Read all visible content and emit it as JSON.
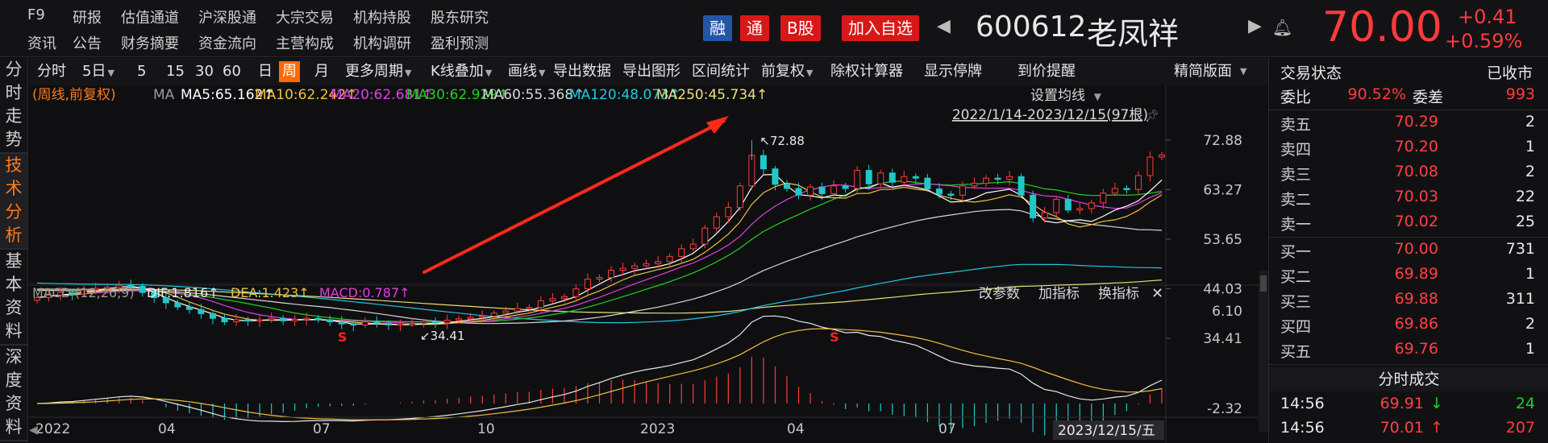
{
  "nav": {
    "row1": [
      "F9",
      "研报",
      "估值通道",
      "沪深股通",
      "大宗交易",
      "机构持股",
      "股东研究"
    ],
    "row2": [
      "资讯",
      "公告",
      "财务摘要",
      "资金流向",
      "主营构成",
      "机构调研",
      "盈利预测"
    ]
  },
  "tags": {
    "rong": "融",
    "tong": "通",
    "bgu": "B股",
    "add": "加入自选"
  },
  "stock": {
    "code": "600612",
    "name": "老凤祥",
    "price": "70.00",
    "change": "+0.41",
    "change_pct": "+0.59%"
  },
  "side_tabs": [
    "分时走势",
    "技术分析",
    "基本资料",
    "深度资料"
  ],
  "toolbar": {
    "items": [
      "分时",
      "5日",
      "5",
      "15",
      "30",
      "60",
      "日",
      "周",
      "月",
      "更多周期",
      "K线叠加",
      "画线",
      "导出数据",
      "导出图形",
      "区间统计",
      "前复权",
      "除权计算器",
      "显示停牌",
      "到价提醒"
    ],
    "active": "周",
    "right": "精简版面"
  },
  "ma_legend": {
    "prefix": "(周线,前复权)",
    "ma_label": "MA",
    "items": [
      "MA5:65.162↑",
      "MA10:62.242↑",
      "MA20:62.681↑",
      "MA30:62.929↑",
      "MA60:55.368↑",
      "MA120:48.073↑",
      "MA250:45.734↑"
    ],
    "settings": "设置均线",
    "range": "2022/1/14-2023/12/15(97根)"
  },
  "colors": {
    "ma5": "#ffffff",
    "ma10": "#f0c040",
    "ma20": "#e040e0",
    "ma30": "#20d020",
    "ma60": "#d8d8d8",
    "ma120": "#20c8e0",
    "ma250": "#e8e080",
    "up": "#ff3b3b",
    "down": "#20c8c8",
    "arrow": "#ff2a1a"
  },
  "chart_annotations": {
    "high": "72.88",
    "low": "34.41",
    "s_marker": "S"
  },
  "macd": {
    "title": "MACD (12,26,9)",
    "dif": "DIF:1.816↑",
    "dea": "DEA:1.423↑",
    "macd": "MACD:0.787↑",
    "btn_params": "改参数",
    "btn_add": "加指标",
    "btn_swap": "换指标",
    "close": "✕"
  },
  "chart_data": {
    "type": "candlestick",
    "y_ticks": [
      "72.88",
      "63.27",
      "53.65",
      "44.03",
      "34.41"
    ],
    "ylim": [
      34.41,
      72.88
    ],
    "macd_ticks": [
      "6.10",
      "-2.32"
    ],
    "macd_lim": [
      -2.32,
      6.1
    ],
    "x_labels": [
      "2022",
      "04",
      "07",
      "10",
      "2023",
      "04",
      "07"
    ],
    "crosshair_label": "2023/12/15/五",
    "weekly_closes": [
      42.3,
      42.8,
      43.3,
      43.0,
      43.8,
      44.1,
      44.3,
      44.7,
      44.5,
      43.3,
      42.3,
      41.3,
      40.5,
      40.0,
      39.2,
      38.3,
      37.6,
      38.0,
      37.8,
      38.0,
      38.3,
      37.8,
      38.1,
      38.3,
      38.0,
      37.6,
      37.2,
      37.0,
      37.6,
      37.3,
      37.0,
      37.2,
      37.3,
      37.6,
      37.4,
      37.9,
      38.2,
      38.5,
      38.7,
      39.3,
      39.7,
      40.2,
      40.4,
      41.7,
      42.1,
      42.5,
      44.0,
      45.9,
      46.2,
      47.6,
      48.0,
      48.5,
      48.9,
      49.3,
      50.3,
      51.8,
      52.7,
      55.8,
      58.0,
      59.8,
      64.0,
      69.9,
      67.3,
      64.3,
      63.5,
      62.2,
      63.8,
      62.5,
      64.0,
      63.5,
      67.0,
      64.4,
      66.5,
      64.7,
      65.8,
      65.5,
      63.4,
      62.4,
      62.2,
      64.0,
      64.5,
      65.5,
      65.3,
      65.8,
      62.2,
      57.8,
      58.8,
      61.4,
      59.3,
      59.6,
      60.7,
      62.6,
      63.5,
      63.3,
      66.0,
      69.6,
      70.0
    ],
    "ma_values": {
      "MA5": 65.162,
      "MA10": 62.242,
      "MA20": 62.681,
      "MA30": 62.929,
      "MA60": 55.368,
      "MA120": 48.073,
      "MA250": 45.734
    },
    "macd_values": {
      "DIF": 1.816,
      "DEA": 1.423,
      "MACD": 0.787
    }
  },
  "panel": {
    "status_label": "交易状态",
    "status_value": "已收市",
    "weibi_label": "委比",
    "weibi_value": "90.52%",
    "weicha_label": "委差",
    "weicha_value": "993",
    "sell": [
      {
        "label": "卖五",
        "price": "70.29",
        "vol": "2"
      },
      {
        "label": "卖四",
        "price": "70.20",
        "vol": "1"
      },
      {
        "label": "卖三",
        "price": "70.08",
        "vol": "2"
      },
      {
        "label": "卖二",
        "price": "70.03",
        "vol": "22"
      },
      {
        "label": "卖一",
        "price": "70.02",
        "vol": "25"
      }
    ],
    "buy": [
      {
        "label": "买一",
        "price": "70.00",
        "vol": "731"
      },
      {
        "label": "买二",
        "price": "69.89",
        "vol": "1"
      },
      {
        "label": "买三",
        "price": "69.88",
        "vol": "311"
      },
      {
        "label": "买四",
        "price": "69.86",
        "vol": "2"
      },
      {
        "label": "买五",
        "price": "69.76",
        "vol": "1"
      }
    ],
    "trades_title": "分时成交",
    "trades": [
      {
        "time": "14:56",
        "price": "69.91",
        "dir": "↓",
        "vol": "24"
      },
      {
        "time": "14:56",
        "price": "70.01",
        "dir": "↑",
        "vol": "207"
      }
    ]
  }
}
